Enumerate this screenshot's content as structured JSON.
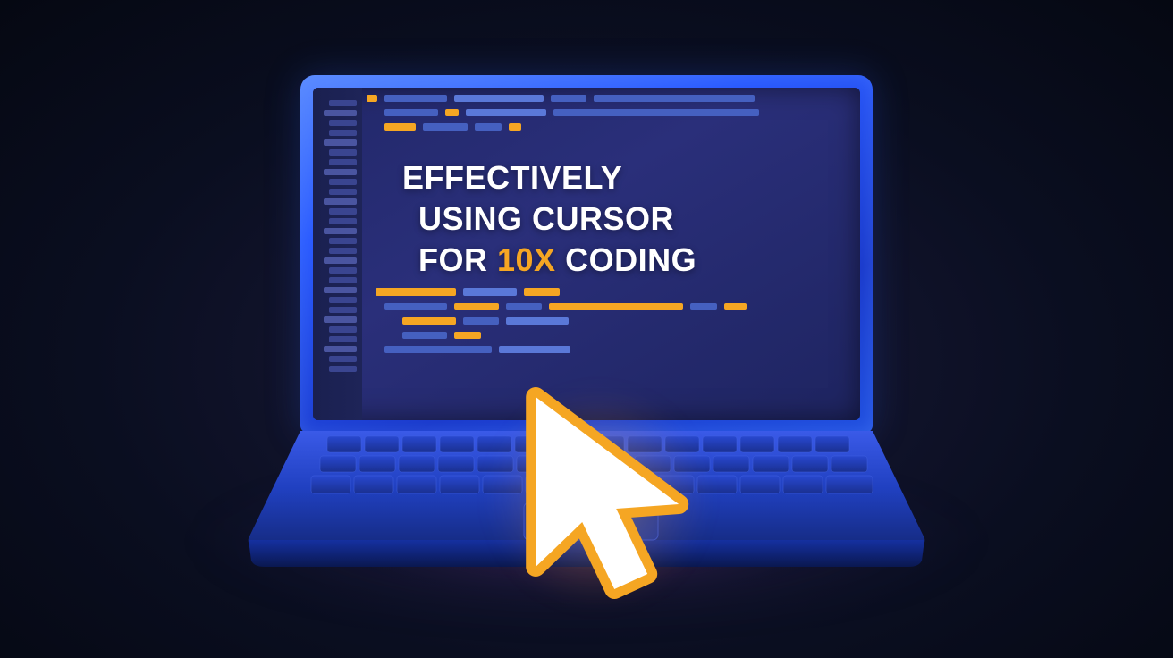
{
  "title": {
    "line1": "EFFECTIVELY",
    "line2_a": "USING CURSOR",
    "line3_a": "FOR ",
    "line3_accent": "10X",
    "line3_b": " CODING"
  },
  "colors": {
    "accent": "#f5a623",
    "text": "#ffffff",
    "screen_bg": "#2a2f7a",
    "bezel": "#2a5aff"
  }
}
